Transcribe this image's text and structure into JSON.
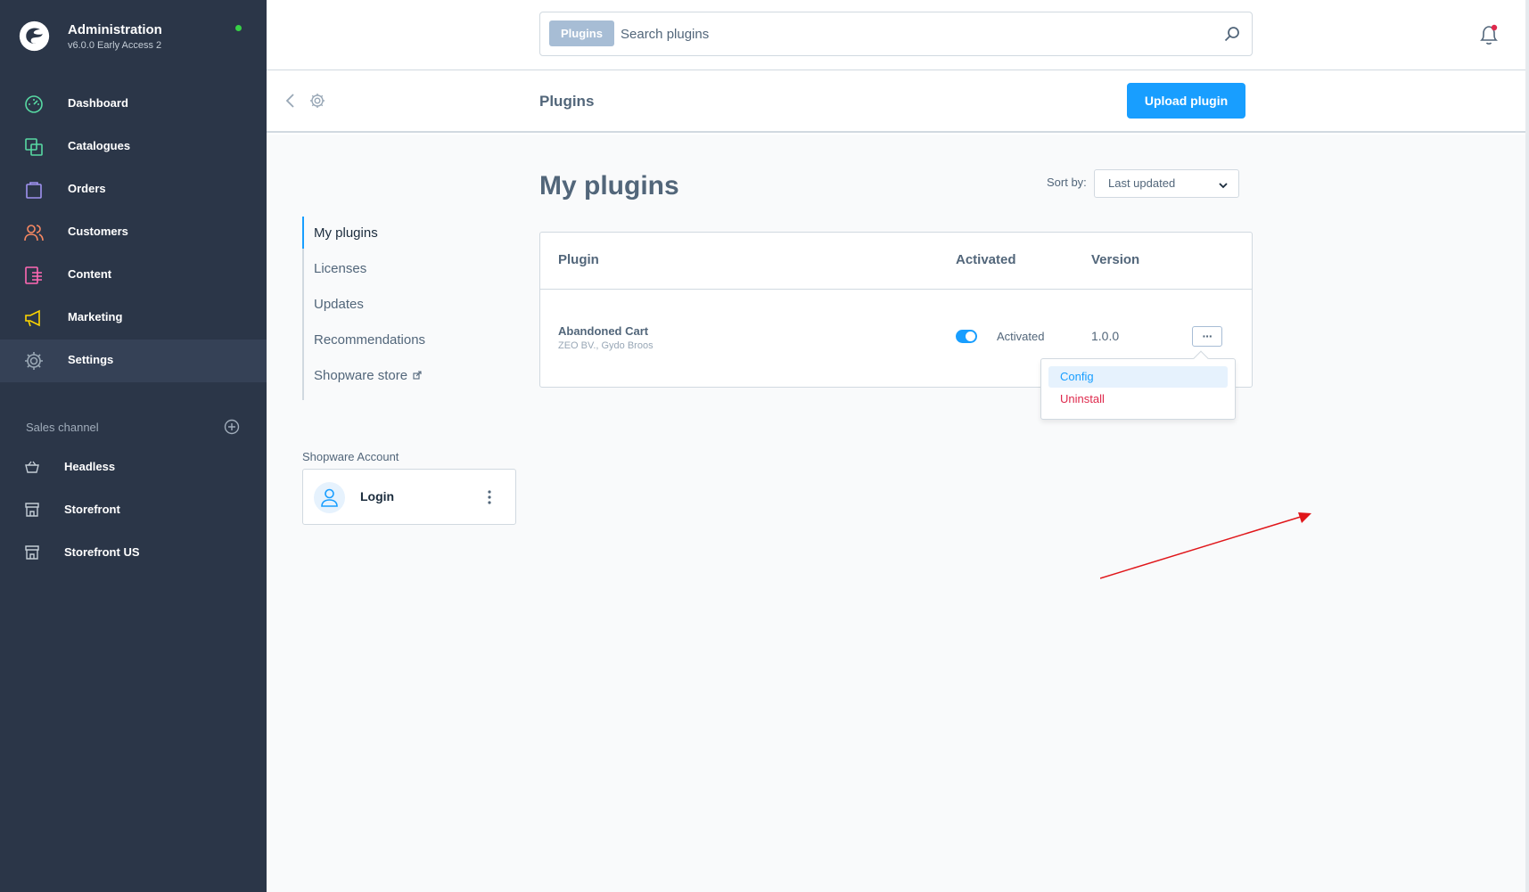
{
  "brand": {
    "title": "Administration",
    "version": "v6.0.0 Early Access 2",
    "status_color": "#37d046"
  },
  "nav": [
    {
      "label": "Dashboard",
      "icon": "dashboard-icon",
      "color": "#57d9a3"
    },
    {
      "label": "Catalogues",
      "icon": "catalogue-icon",
      "color": "#57d9a3"
    },
    {
      "label": "Orders",
      "icon": "orders-icon",
      "color": "#a092f0"
    },
    {
      "label": "Customers",
      "icon": "customers-icon",
      "color": "#f88962"
    },
    {
      "label": "Content",
      "icon": "content-icon",
      "color": "#ff68b4"
    },
    {
      "label": "Marketing",
      "icon": "marketing-icon",
      "color": "#ffd700"
    },
    {
      "label": "Settings",
      "icon": "settings-icon",
      "color": "#9aa8b5",
      "active": true
    }
  ],
  "sales_channel": {
    "title": "Sales channel",
    "items": [
      {
        "label": "Headless",
        "icon": "basket-icon"
      },
      {
        "label": "Storefront",
        "icon": "storefront-icon"
      },
      {
        "label": "Storefront US",
        "icon": "storefront-icon"
      }
    ]
  },
  "search": {
    "tag": "Plugins",
    "placeholder": "Search plugins"
  },
  "smartbar": {
    "title": "Plugins",
    "upload_label": "Upload plugin"
  },
  "side_nav": {
    "items": [
      {
        "label": "My plugins",
        "active": true
      },
      {
        "label": "Licenses"
      },
      {
        "label": "Updates"
      },
      {
        "label": "Recommendations"
      },
      {
        "label": "Shopware store",
        "external": true
      }
    ]
  },
  "account": {
    "section_label": "Shopware Account",
    "login_label": "Login"
  },
  "main": {
    "title": "My plugins",
    "sort_label": "Sort by:",
    "sort_value": "Last updated"
  },
  "grid": {
    "columns": [
      "Plugin",
      "Activated",
      "Version"
    ],
    "rows": [
      {
        "name": "Abandoned Cart",
        "author": "ZEO BV., Gydo Broos",
        "activated": true,
        "activated_label": "Activated",
        "version": "1.0.0",
        "context_label": "···"
      }
    ]
  },
  "context_menu": {
    "items": [
      {
        "label": "Config",
        "highlighted": true
      },
      {
        "label": "Uninstall",
        "danger": true
      }
    ]
  },
  "colors": {
    "accent": "#189eff",
    "danger": "#de294c",
    "sidebar_bg": "#2b3648",
    "annotation": "#e0161a"
  }
}
